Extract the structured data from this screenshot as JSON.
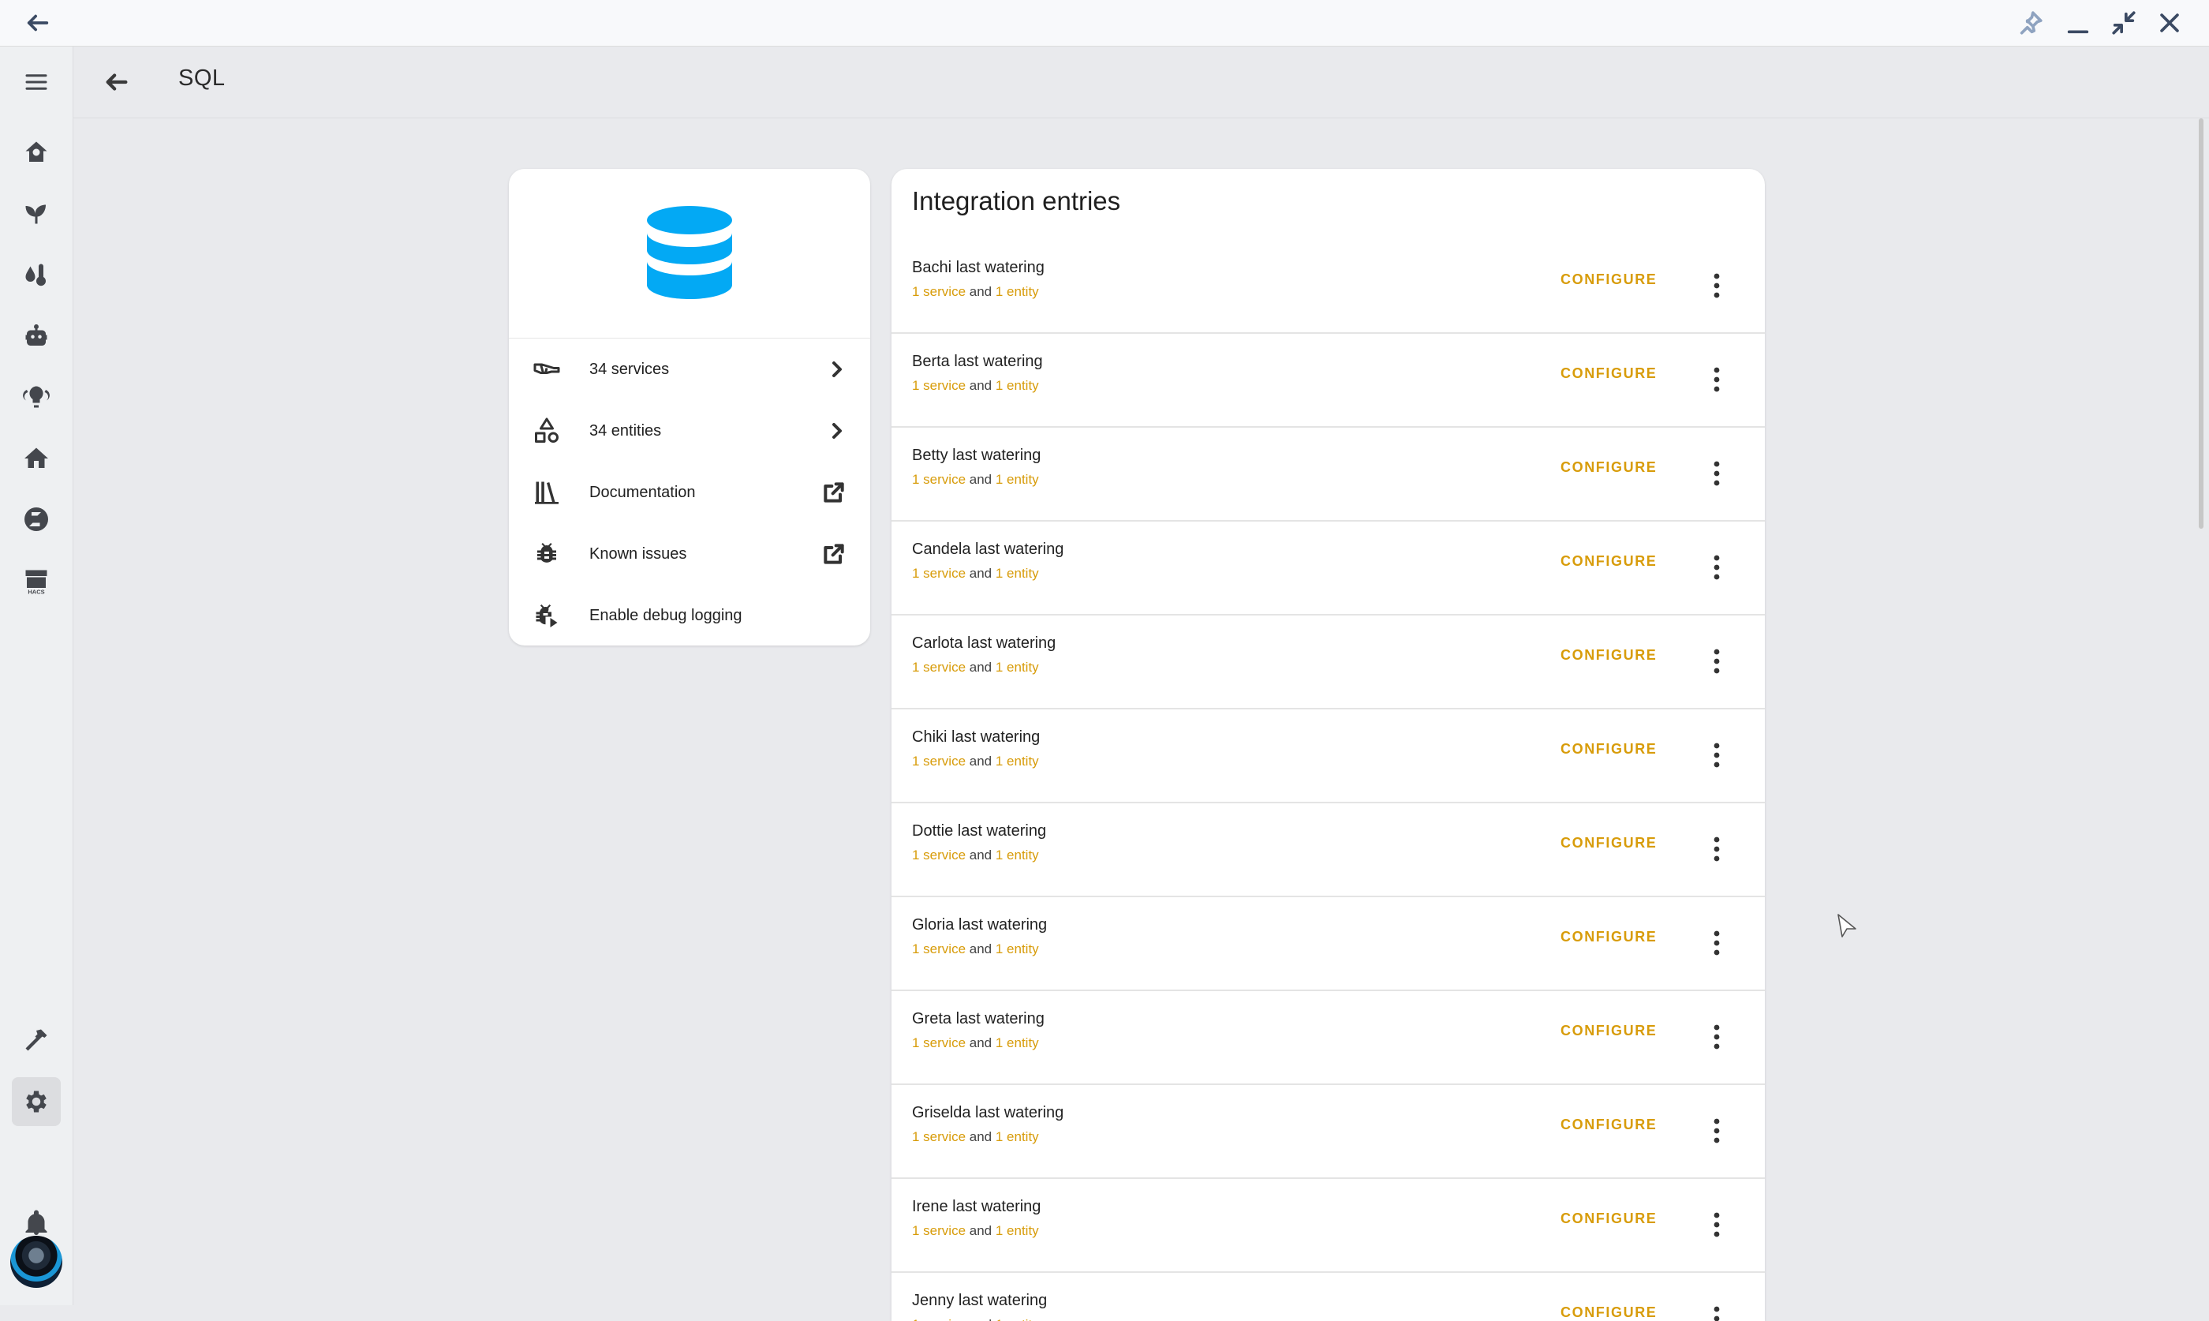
{
  "window": {
    "back_icon": "arrow-left-icon",
    "controls": [
      "pin-icon",
      "minimize-icon",
      "restore-icon",
      "close-icon"
    ]
  },
  "sidebar": {
    "items": [
      {
        "icon": "menu-icon"
      },
      {
        "icon": "home-outline-icon"
      },
      {
        "icon": "plant-icon"
      },
      {
        "icon": "water-thermometer-icon"
      },
      {
        "icon": "robot-icon"
      },
      {
        "icon": "lightbulb-group-icon"
      },
      {
        "icon": "home-icon"
      },
      {
        "icon": "zigbee-icon"
      },
      {
        "icon": "hacs-icon",
        "label": "HACS"
      },
      {
        "icon": "hammer-icon"
      },
      {
        "icon": "settings-icon",
        "active": true
      },
      {
        "icon": "bell-icon"
      },
      {
        "icon": "avatar"
      }
    ]
  },
  "header": {
    "title": "SQL"
  },
  "info_card": {
    "logo": "database-icon",
    "logo_color": "#03a9f4",
    "rows": [
      {
        "icon": "service-hand-icon",
        "label": "34 services",
        "trailing": "chevron-right-icon"
      },
      {
        "icon": "shapes-icon",
        "label": "34 entities",
        "trailing": "chevron-right-icon"
      },
      {
        "icon": "book-icon",
        "label": "Documentation",
        "trailing": "open-external-icon"
      },
      {
        "icon": "bug-icon",
        "label": "Known issues",
        "trailing": "open-external-icon"
      },
      {
        "icon": "bug-play-icon",
        "label": "Enable debug logging",
        "trailing": ""
      }
    ]
  },
  "entries": {
    "title": "Integration entries",
    "configure_label": "CONFIGURE",
    "accent_color": "#d89c0a",
    "sub": {
      "services": "1 service",
      "and": "and",
      "entities": "1 entity"
    },
    "items": [
      {
        "name": "Bachi last watering"
      },
      {
        "name": "Berta last watering"
      },
      {
        "name": "Betty last watering"
      },
      {
        "name": "Candela last watering"
      },
      {
        "name": "Carlota last watering"
      },
      {
        "name": "Chiki last watering"
      },
      {
        "name": "Dottie last watering"
      },
      {
        "name": "Gloria last watering"
      },
      {
        "name": "Greta last watering"
      },
      {
        "name": "Griselda last watering"
      },
      {
        "name": "Irene last watering"
      },
      {
        "name": "Jenny last watering"
      }
    ]
  }
}
